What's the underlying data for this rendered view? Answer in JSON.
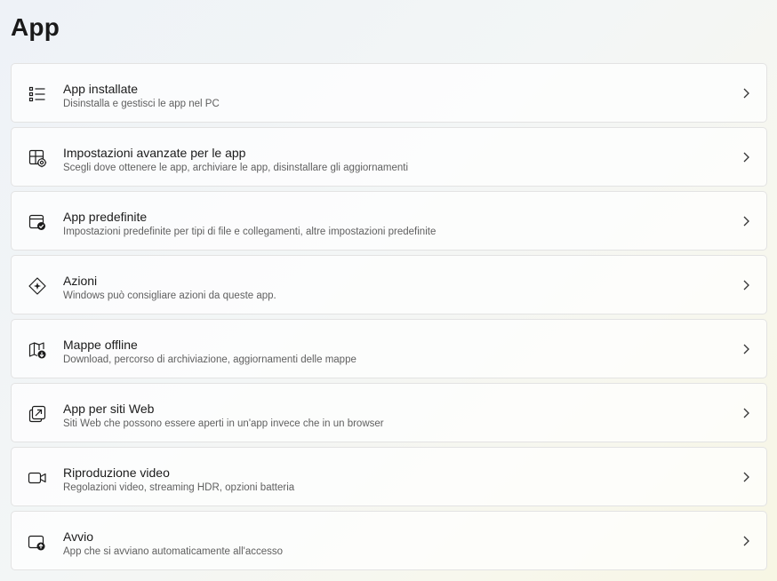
{
  "page": {
    "title": "App"
  },
  "items": [
    {
      "icon": "list-icon",
      "title": "App installate",
      "subtitle": "Disinstalla e gestisci le app nel PC"
    },
    {
      "icon": "advanced-app-settings-icon",
      "title": "Impostazioni avanzate per le app",
      "subtitle": "Scegli dove ottenere le app, archiviare le app, disinstallare gli aggiornamenti"
    },
    {
      "icon": "default-apps-icon",
      "title": "App predefinite",
      "subtitle": "Impostazioni predefinite per tipi di file e collegamenti, altre impostazioni predefinite"
    },
    {
      "icon": "actions-icon",
      "title": "Azioni",
      "subtitle": "Windows può consigliare azioni da queste app."
    },
    {
      "icon": "offline-maps-icon",
      "title": "Mappe offline",
      "subtitle": "Download, percorso di archiviazione, aggiornamenti delle mappe"
    },
    {
      "icon": "apps-for-websites-icon",
      "title": "App per siti Web",
      "subtitle": "Siti Web che possono essere aperti in un'app invece che in un browser"
    },
    {
      "icon": "video-camera-icon",
      "title": "Riproduzione video",
      "subtitle": "Regolazioni video, streaming HDR, opzioni batteria"
    },
    {
      "icon": "startup-apps-icon",
      "title": "Avvio",
      "subtitle": "App che si avviano automaticamente all'accesso"
    }
  ]
}
